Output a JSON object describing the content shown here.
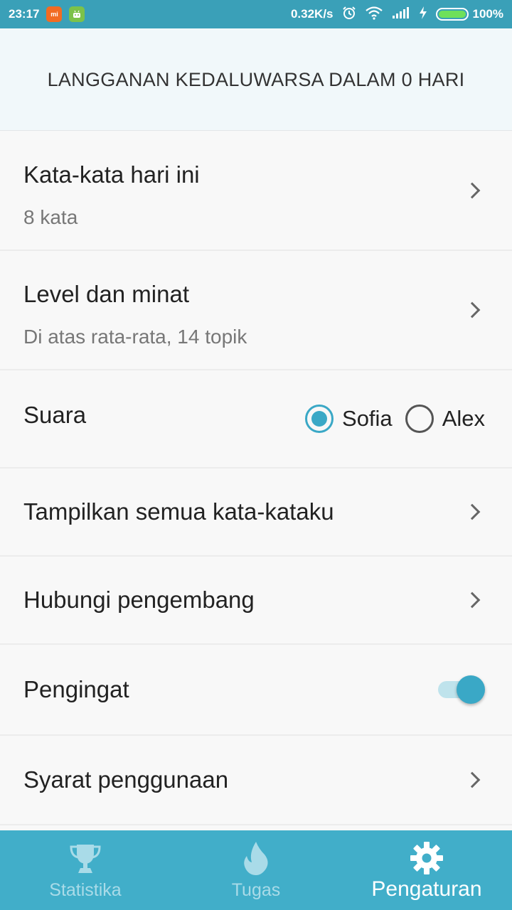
{
  "status_bar": {
    "time": "23:17",
    "network_speed": "0.32K/s",
    "battery_percent": "100%",
    "icons": [
      "mi-app-icon",
      "android-app-icon",
      "alarm-icon",
      "wifi-icon",
      "signal-icon",
      "charging-icon",
      "battery-icon"
    ]
  },
  "banner": {
    "text": "LANGGANAN KEDALUWARSA DALAM 0 HARI"
  },
  "settings": {
    "words_today": {
      "title": "Kata-kata hari ini",
      "subtitle": "8 kata"
    },
    "level": {
      "title": "Level dan minat",
      "subtitle": "Di atas rata-rata, 14 topik"
    },
    "voice": {
      "title": "Suara",
      "options": [
        {
          "label": "Sofia",
          "selected": true
        },
        {
          "label": "Alex",
          "selected": false
        }
      ]
    },
    "show_words": {
      "title": "Tampilkan semua kata-kataku"
    },
    "contact": {
      "title": "Hubungi pengembang"
    },
    "reminder": {
      "title": "Pengingat",
      "enabled": true
    },
    "terms": {
      "title": "Syarat penggunaan"
    }
  },
  "bottom_nav": {
    "items": [
      {
        "label": "Statistika",
        "icon": "trophy-icon",
        "active": false
      },
      {
        "label": "Tugas",
        "icon": "flame-icon",
        "active": false
      },
      {
        "label": "Pengaturan",
        "icon": "gear-icon",
        "active": true
      }
    ]
  },
  "colors": {
    "accent": "#3aa8c6",
    "status_bar": "#3aa0b8",
    "nav_bar": "#41aec9"
  }
}
